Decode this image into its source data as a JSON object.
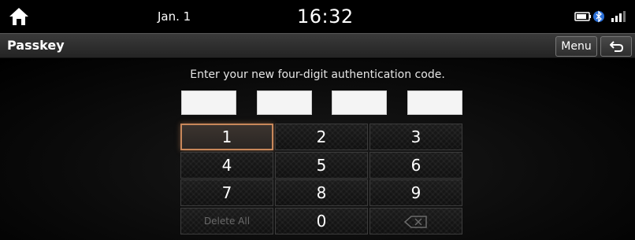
{
  "status": {
    "date": "Jan. 1",
    "time": "16:32",
    "icons": [
      "battery-icon",
      "bluetooth-icon",
      "signal-icon"
    ]
  },
  "header": {
    "title": "Passkey",
    "menu_label": "Menu"
  },
  "main": {
    "prompt": "Enter your new four-digit authentication code.",
    "code_digits": [
      "",
      "",
      "",
      ""
    ],
    "keypad": {
      "k1": "1",
      "k2": "2",
      "k3": "3",
      "k4": "4",
      "k5": "5",
      "k6": "6",
      "k7": "7",
      "k8": "8",
      "k9": "9",
      "delete_all": "Delete All",
      "k0": "0"
    }
  },
  "colors": {
    "focus_border": "#c8875a",
    "code_box": "#f4f4f4"
  }
}
